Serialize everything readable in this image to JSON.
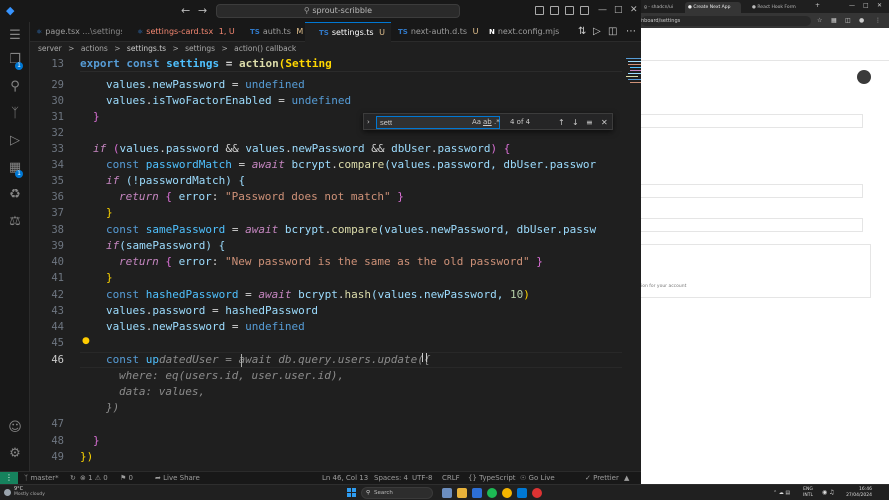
{
  "vscode": {
    "search_title": "sprout-scribble",
    "tabs": [
      {
        "label": "page.tsx",
        "detail": "...\\settings",
        "status": "U"
      },
      {
        "label": "settings-card.tsx",
        "detail": "",
        "status": "1, U"
      },
      {
        "label": "auth.ts",
        "detail": "",
        "status": "M"
      },
      {
        "label": "settings.ts",
        "detail": "",
        "status": "U"
      },
      {
        "label": "next-auth.d.ts",
        "detail": "",
        "status": "U"
      },
      {
        "label": "next.config.mjs",
        "detail": "",
        "status": ""
      }
    ],
    "breadcrumb": [
      "server",
      ">",
      "actions",
      ">",
      "settings.ts",
      ">",
      "settings",
      ">",
      "action() callback"
    ],
    "find": {
      "query": "sett",
      "count": "4 of 4",
      "opt_case": "Aa",
      "opt_word": "ab",
      "opt_regex": ".*"
    },
    "gutter": [
      "13",
      "29",
      "30",
      "31",
      "32",
      "33",
      "34",
      "35",
      "36",
      "37",
      "38",
      "39",
      "40",
      "41",
      "42",
      "43",
      "44",
      "45",
      "46",
      "",
      "",
      "",
      "47",
      "48",
      "49"
    ],
    "code": {
      "sticky": {
        "kw": "export",
        "kw2": "const",
        "name": "settings",
        "eq": "=",
        "fn": "action",
        "rest": "(Setting"
      },
      "l29": {
        "obj": "values",
        "prop": "newPassword",
        "eq": " = ",
        "val": "undefined"
      },
      "l30": {
        "obj": "values",
        "prop": "isTwoFactorEnabled",
        "eq": " = ",
        "val": "undefined"
      },
      "l31": "}",
      "l33": {
        "kw": "if",
        "open": " (",
        "a": "values",
        "ap": "password",
        "and1": " && ",
        "b": "values",
        "bp": "newPassword",
        "and2": " && ",
        "c": "dbUser",
        "cp": "password",
        "close": ") {"
      },
      "l34": {
        "kw": "const",
        "name": "passwordMatch",
        "eq": " = ",
        "aw": "await",
        "obj": "bcrypt",
        "fn": "compare",
        "args": "(values.password, dbUser.passwor"
      },
      "l35": {
        "kw": "if",
        "rest": " (!passwordMatch) {"
      },
      "l36": {
        "kw": "return",
        "open": " { ",
        "key": "error",
        "colon": ": ",
        "str": "\"Password does not match\"",
        "close": " }"
      },
      "l37": "}",
      "l38": {
        "kw": "const",
        "name": "samePassword",
        "eq": " = ",
        "aw": "await",
        "obj": "bcrypt",
        "fn": "compare",
        "args": "(values.newPassword, dbUser.passw"
      },
      "l39": {
        "kw": "if",
        "rest": "(samePassword) {"
      },
      "l40": {
        "kw": "return",
        "open": " { ",
        "key": "error",
        "colon": ": ",
        "str": "\"New password is the same as the old password\"",
        "close": " }"
      },
      "l41": "}",
      "l42": {
        "kw": "const",
        "name": "hashedPassword",
        "eq": " = ",
        "aw": "await",
        "obj": "bcrypt",
        "fn": "hash",
        "args": "(values.newPassword, ",
        "num": "10",
        "end": ")"
      },
      "l43": {
        "obj": "values",
        "prop": "password",
        "eq": " = ",
        "val": "hashedPassword"
      },
      "l44": {
        "obj": "values",
        "prop": "newPassword",
        "eq": " = ",
        "val": "undefined"
      },
      "l46": {
        "kw": "const",
        "typed": "up",
        "ghost": "datedUser = await db.query.users.update({"
      },
      "g1": "where: eq(users.id, user.user.id),",
      "g2": "data: values,",
      "g3": "})",
      "l48": "}",
      "l49": "})"
    },
    "status": {
      "branch": "master*",
      "problems": "⊗ 1 ⚠ 0",
      "ports": "⚑ 0",
      "live_share": "Live Share",
      "position": "Ln 46, Col 13",
      "spaces": "Spaces: 4",
      "encoding": "UTF-8",
      "eol": "CRLF",
      "language": "{} TypeScript",
      "golive": "Go Live",
      "prettier": "✓ Prettier",
      "bell": "🔔"
    }
  },
  "browser": {
    "tabs": [
      {
        "label": "g - shadcn/ui"
      },
      {
        "label": "Create Next App"
      },
      {
        "label": "React Hook Form"
      }
    ],
    "url": "hboard/settings",
    "note": "ion for your account"
  },
  "taskbar": {
    "weather_temp": "9°C",
    "weather_desc": "Mostly cloudy",
    "search": "Search",
    "lang_top": "ENG",
    "lang_bottom": "INTL",
    "time": "16:46",
    "date": "27/04/2024"
  },
  "colors": {
    "accent": "#0078d4",
    "remote": "#16825d",
    "keyword": "#569cd6",
    "control": "#c586c0",
    "variable": "#9cdcfe",
    "string": "#ce9178",
    "function": "#dcdcaa"
  }
}
